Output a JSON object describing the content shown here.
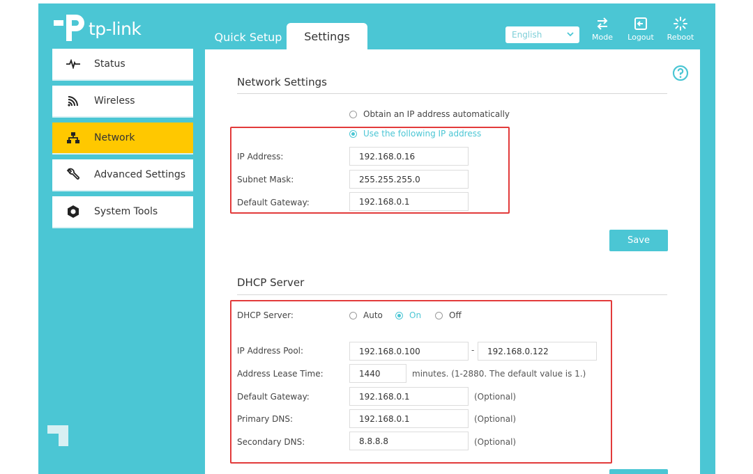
{
  "brand": {
    "name": "tp-link"
  },
  "tabs": {
    "quick_setup": "Quick Setup",
    "settings": "Settings"
  },
  "language": {
    "selected": "English"
  },
  "top_actions": {
    "mode": "Mode",
    "logout": "Logout",
    "reboot": "Reboot"
  },
  "sidebar": {
    "items": [
      {
        "label": "Status",
        "icon": "pulse-icon"
      },
      {
        "label": "Wireless",
        "icon": "wifi-icon"
      },
      {
        "label": "Network",
        "icon": "network-icon",
        "active": true
      },
      {
        "label": "Advanced Settings",
        "icon": "wrench-icon"
      },
      {
        "label": "System Tools",
        "icon": "gear-icon"
      }
    ]
  },
  "network_settings": {
    "title": "Network Settings",
    "option_auto": "Obtain an IP address automatically",
    "option_static": "Use the following IP address",
    "selected": "static",
    "ip_label": "IP Address:",
    "ip_value": "192.168.0.16",
    "mask_label": "Subnet Mask:",
    "mask_value": "255.255.255.0",
    "gateway_label": "Default Gateway:",
    "gateway_value": "192.168.0.1",
    "save": "Save"
  },
  "dhcp": {
    "title": "DHCP Server",
    "server_label": "DHCP Server:",
    "opt_auto": "Auto",
    "opt_on": "On",
    "opt_off": "Off",
    "selected": "On",
    "pool_label": "IP Address Pool:",
    "pool_start": "192.168.0.100",
    "pool_sep": "-",
    "pool_end": "192.168.0.122",
    "lease_label": "Address Lease Time:",
    "lease_value": "1440",
    "lease_note": "minutes. (1-2880. The default value is 1.)",
    "gateway_label": "Default Gateway:",
    "gateway_value": "192.168.0.1",
    "primary_dns_label": "Primary DNS:",
    "primary_dns_value": "192.168.0.1",
    "secondary_dns_label": "Secondary DNS:",
    "secondary_dns_value": "8.8.8.8",
    "optional": "(Optional)"
  },
  "colors": {
    "accent": "#4bc6d4",
    "active_nav": "#ffc800",
    "highlight_box": "#e23a3a"
  }
}
